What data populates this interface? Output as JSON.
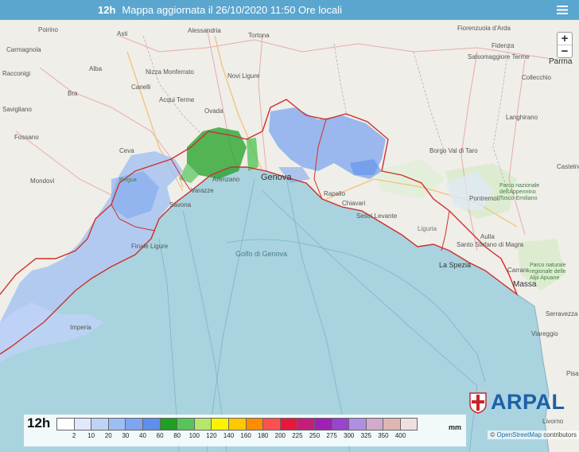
{
  "header": {
    "period": "12h",
    "title": "Mappa aggiornata il 26/10/2020 11:50 Ore locali",
    "menu_icon": "hamburger-menu-icon"
  },
  "zoom": {
    "in_label": "+",
    "out_label": "−"
  },
  "map_labels": {
    "sea": "Golfo di Genova",
    "cities": [
      "Asti",
      "Alessandria",
      "Tortona",
      "Carmagnola",
      "Poirino",
      "Racconigi",
      "Bra",
      "Alba",
      "Canelli",
      "Nizza Monferrato",
      "Acqui Terme",
      "Novi Ligure",
      "Ovada",
      "Savigliano",
      "Fossano",
      "Mondovì",
      "Savona",
      "Varazze",
      "Arenzano",
      "Genova",
      "Rapallo",
      "Chiavari",
      "Sestri Levante",
      "La Spezia",
      "Carrara",
      "Massa",
      "Viareggio",
      "Pisa",
      "Livorno",
      "Parma",
      "Fidenza",
      "Salsomaggiore Terme",
      "Collecchio",
      "Langhirano",
      "Borgo Val di Taro",
      "Pontremoli",
      "Castelnovo ne' Monti",
      "Fiorenzuola d'Arda",
      "Aulla",
      "Santo Stefano di Magra",
      "Imperia",
      "Finale Ligure",
      "Ceva",
      "Liguria",
      "Serravezza"
    ],
    "parks": [
      "Parco nazionale dell'Appennino Tosco-Emiliano",
      "Parco naturale regionale delle Alpi Apuane",
      "Beigua"
    ]
  },
  "logo": {
    "text": "ARPAL",
    "icon": "liguria-cross-emblem"
  },
  "attribution": {
    "prefix": "©",
    "link": "OpenStreetMap",
    "suffix": "contributors"
  },
  "legend": {
    "period": "12h",
    "unit": "mm",
    "ticks": [
      "2",
      "10",
      "20",
      "30",
      "40",
      "60",
      "80",
      "100",
      "120",
      "140",
      "160",
      "180",
      "200",
      "225",
      "250",
      "275",
      "300",
      "325",
      "350",
      "400"
    ],
    "colors": [
      "#ffffff",
      "#dfe9fb",
      "#bfd3f7",
      "#9ebdf3",
      "#7ea6ef",
      "#5f8fea",
      "#1ea024",
      "#56c45a",
      "#b5e86a",
      "#fff200",
      "#ffc800",
      "#ff8c00",
      "#ff5050",
      "#e6193c",
      "#c21e7a",
      "#a020b4",
      "#9a43cf",
      "#b08ee2",
      "#d2aacd",
      "#deb6b4",
      "#efe0e0"
    ]
  }
}
